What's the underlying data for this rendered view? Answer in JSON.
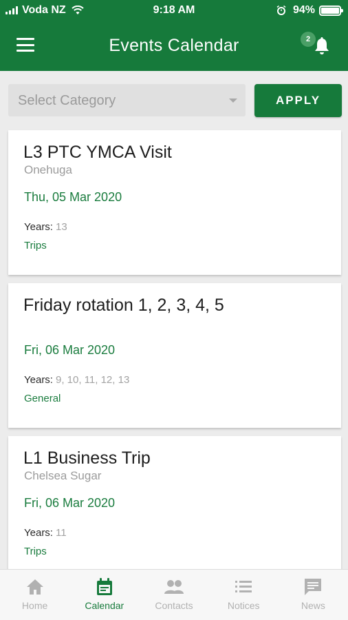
{
  "status_bar": {
    "carrier": "Voda NZ",
    "time": "9:18 AM",
    "battery": "94%",
    "battery_level": 0.94
  },
  "app_bar": {
    "title": "Events Calendar",
    "notification_count": "2"
  },
  "filter": {
    "select_placeholder": "Select Category",
    "apply_label": "APPLY"
  },
  "events": [
    {
      "title": "L3 PTC YMCA Visit",
      "location": "Onehuga",
      "date": "Thu, 05 Mar 2020",
      "years_label": "Years:",
      "years": "13",
      "type": "Trips"
    },
    {
      "title": "Friday rotation 1, 2, 3, 4, 5",
      "location": "",
      "date": "Fri, 06 Mar 2020",
      "years_label": "Years:",
      "years": "9, 10, 11, 12, 13",
      "type": "General"
    },
    {
      "title": "L1 Business Trip",
      "location": "Chelsea Sugar",
      "date": "Fri, 06 Mar 2020",
      "years_label": "Years:",
      "years": "11",
      "type": "Trips"
    }
  ],
  "tabs": [
    {
      "label": "Home",
      "icon": "home-icon",
      "active": false
    },
    {
      "label": "Calendar",
      "icon": "calendar-icon",
      "active": true
    },
    {
      "label": "Contacts",
      "icon": "contacts-icon",
      "active": false
    },
    {
      "label": "Notices",
      "icon": "list-icon",
      "active": false
    },
    {
      "label": "News",
      "icon": "chat-icon",
      "active": false
    }
  ],
  "colors": {
    "brand": "#167a3b",
    "accent_text": "#1a7c3e",
    "inactive_tab": "#b1b1b1"
  }
}
